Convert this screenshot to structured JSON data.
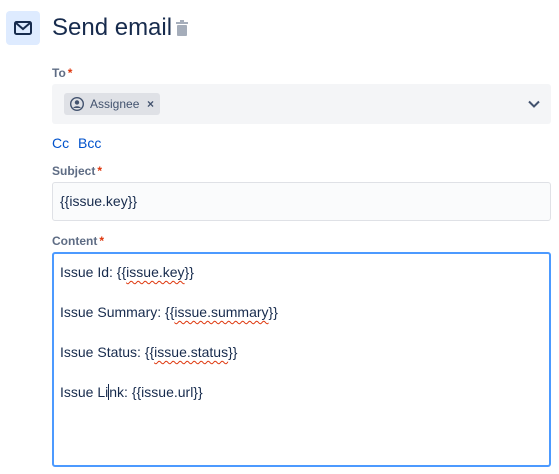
{
  "header": {
    "title": "Send email",
    "icon": "envelope-icon",
    "delete_icon": "trash-icon"
  },
  "to": {
    "label": "To",
    "required": "*",
    "recipients": [
      {
        "label": "Assignee",
        "icon": "user-avatar-icon",
        "remove": "×"
      }
    ],
    "dropdown_icon": "chevron-down-icon"
  },
  "cc_links": {
    "cc": "Cc",
    "bcc": "Bcc"
  },
  "subject": {
    "label": "Subject",
    "required": "*",
    "value": "{{issue.key}}"
  },
  "content": {
    "label": "Content",
    "required": "*",
    "lines": [
      {
        "prefix": "Issue Id: {{",
        "marked": "issue.key",
        "suffix": "}}"
      },
      {
        "prefix": "Issue Summary: {{",
        "marked": "issue.summary",
        "suffix": "}}"
      },
      {
        "prefix": "Issue Status: {{",
        "marked": "issue.status",
        "suffix": "}}"
      },
      {
        "before_caret": "Issue Li",
        "after_caret": "nk: {{issue.url}}"
      }
    ]
  },
  "colors": {
    "accent": "#0052cc",
    "focus_border": "#4c9aff",
    "required": "#de350b",
    "icon_bg": "#deebff"
  }
}
